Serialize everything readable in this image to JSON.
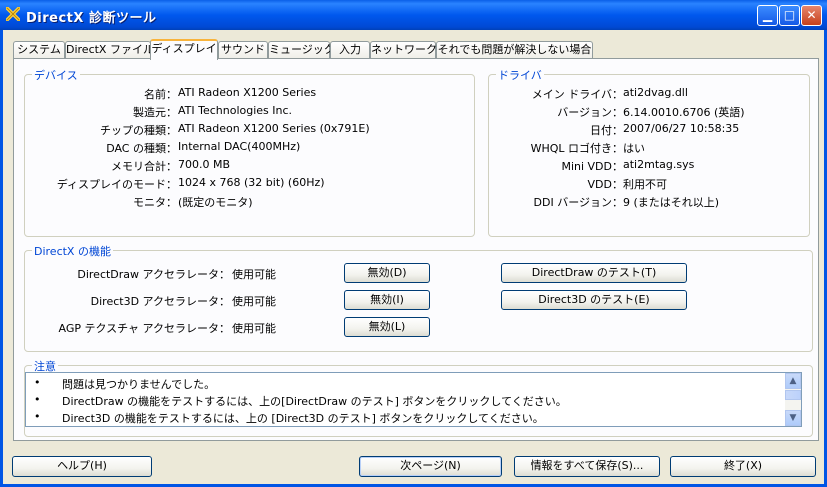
{
  "window": {
    "title": "DirectX 診断ツール"
  },
  "tabs": [
    {
      "label": "システム"
    },
    {
      "label": "DirectX ファイル"
    },
    {
      "label": "ディスプレイ"
    },
    {
      "label": "サウンド"
    },
    {
      "label": "ミュージック"
    },
    {
      "label": "入力"
    },
    {
      "label": "ネットワーク"
    },
    {
      "label": "それでも問題が解決しない場合"
    }
  ],
  "device": {
    "title": "デバイス",
    "rows": [
      {
        "label": "名前：",
        "value": "ATI Radeon X1200 Series"
      },
      {
        "label": "製造元：",
        "value": "ATI Technologies Inc."
      },
      {
        "label": "チップの種類：",
        "value": "ATI Radeon X1200 Series (0x791E)"
      },
      {
        "label": "DAC の種類：",
        "value": "Internal DAC(400MHz)"
      },
      {
        "label": "メモリ合計：",
        "value": "700.0 MB"
      },
      {
        "label": "ディスプレイのモード：",
        "value": "1024 x 768 (32 bit) (60Hz)"
      },
      {
        "label": "モニタ：",
        "value": "(既定のモニタ)"
      }
    ]
  },
  "driver": {
    "title": "ドライバ",
    "rows": [
      {
        "label": "メイン ドライバ：",
        "value": "ati2dvag.dll"
      },
      {
        "label": "バージョン：",
        "value": "6.14.0010.6706 (英語)"
      },
      {
        "label": "日付：",
        "value": "2007/06/27 10:58:35"
      },
      {
        "label": "WHQL ロゴ付き：",
        "value": "はい"
      },
      {
        "label": "Mini VDD：",
        "value": "ati2mtag.sys"
      },
      {
        "label": "VDD：",
        "value": "利用不可"
      },
      {
        "label": "DDI バージョン：",
        "value": "9 (またはそれ以上)"
      }
    ]
  },
  "features": {
    "title": "DirectX の機能",
    "rows": [
      {
        "label": "DirectDraw アクセラレータ：",
        "status": "使用可能",
        "toggle": "無効(D)",
        "test": "DirectDraw のテスト(T)"
      },
      {
        "label": "Direct3D アクセラレータ：",
        "status": "使用可能",
        "toggle": "無効(I)",
        "test": "Direct3D のテスト(E)"
      },
      {
        "label": "AGP テクスチャ アクセラレータ：",
        "status": "使用可能",
        "toggle": "無効(L)"
      }
    ]
  },
  "notes": {
    "title": "注意",
    "bullet": "•",
    "items": [
      "問題は見つかりませんでした。",
      "DirectDraw の機能をテストするには、上の[DirectDraw のテスト] ボタンをクリックしてください。",
      "Direct3D の機能をテストするには、上の [Direct3D のテスト] ボタンをクリックしてください。"
    ]
  },
  "buttons": {
    "help": "ヘルプ(H)",
    "next": "次ページ(N)",
    "save_all": "情報をすべて保存(S)...",
    "exit": "終了(X)"
  },
  "colors": {
    "titlebar": "#0058ee",
    "group_title": "#0046d5",
    "tab_highlight": "#f9b43c"
  }
}
